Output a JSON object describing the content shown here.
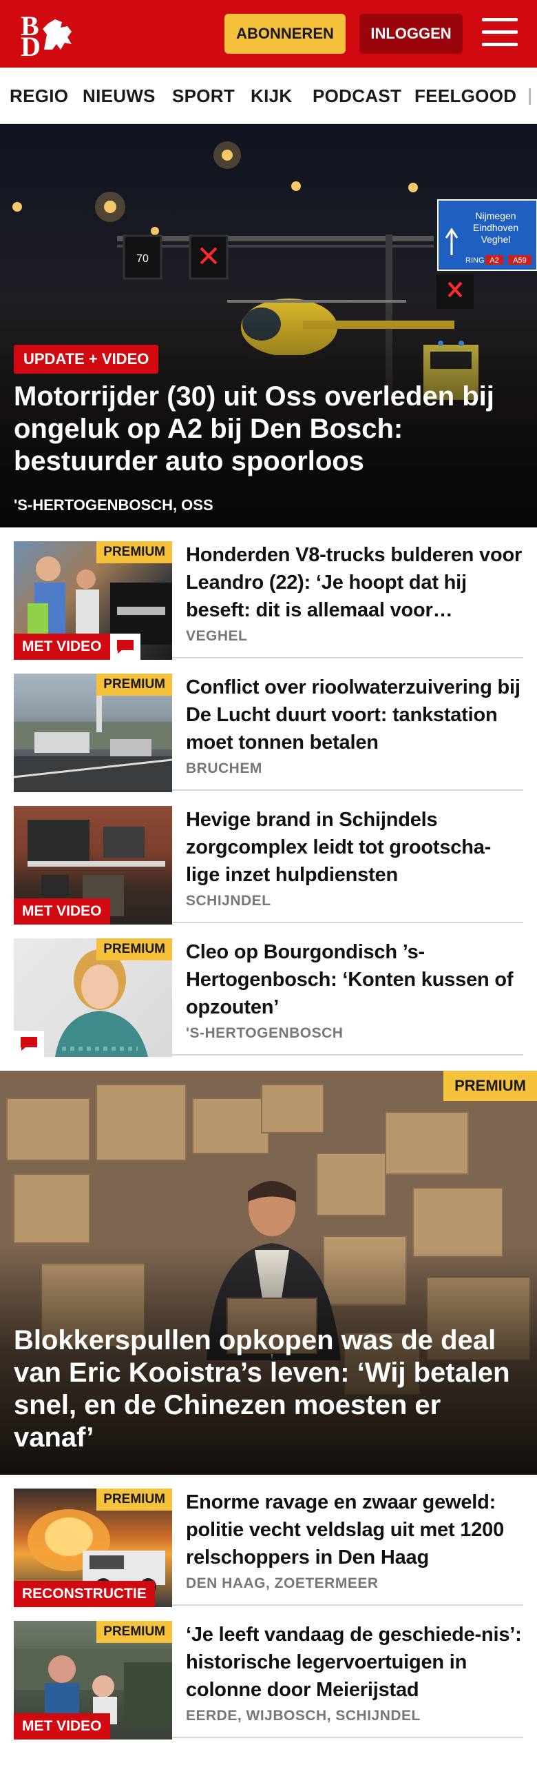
{
  "header": {
    "logo_text": "BD",
    "subscribe_label": "ABONNEREN",
    "login_label": "INLOGGEN",
    "brand_color": "#d10a11",
    "accent_color": "#f6c23c"
  },
  "nav": {
    "items": [
      {
        "label": "REGIO"
      },
      {
        "label": "NIEUWS"
      },
      {
        "label": "SPORT"
      },
      {
        "label": "KIJK"
      },
      {
        "label": "PODCAST"
      },
      {
        "label": "FEELGOOD"
      }
    ]
  },
  "hero": {
    "tag": "UPDATE + VIDEO",
    "title": "Motorrijder (30) uit Oss overleden bij ongeluk op A2 bij Den Bosch: bestuurder auto spoorloos",
    "location": "'S-HERTOGENBOSCH, OSS",
    "scene": {
      "speed_sign": "70",
      "route_sign_lines": [
        "Nijmegen",
        "Eindhoven",
        "Veghel"
      ],
      "route_sign_ring": "RING",
      "route_sign_roads": [
        "A2",
        "A59"
      ]
    }
  },
  "articles": [
    {
      "premium": "PREMIUM",
      "badge": "MET VIDEO",
      "comment_icon": "comment-icon",
      "title": "Honderden V8-trucks bulderen voor Leandro (22): ‘Je hoopt dat hij beseft: dit is allemaal voor…",
      "location": "VEGHEL"
    },
    {
      "premium": "PREMIUM",
      "title": "Conflict over rioolwaterzuivering bij De Lucht duurt voort: tankstation moet tonnen betalen",
      "location": "BRUCHEM"
    },
    {
      "badge": "MET VIDEO",
      "title": "Hevige brand in Schijndels zorgcomplex leidt tot grootscha-lige inzet hulpdiensten",
      "location": "SCHIJNDEL"
    },
    {
      "premium": "PREMIUM",
      "comment_icon": "comment-icon",
      "title": "Cleo op Bourgondisch ’s-Hertogenbosch: ‘Konten kussen of opzouten’",
      "location": "'S-HERTOGENBOSCH"
    }
  ],
  "hero2": {
    "premium": "PREMIUM",
    "title": "Blokkerspullen opkopen was de deal van Eric Kooistra’s leven: ‘Wij betalen snel, en de Chinezen moesten er vanaf’"
  },
  "articles2": [
    {
      "premium": "PREMIUM",
      "badge": "RECONSTRUCTIE",
      "title": "Enorme ravage en zwaar geweld: politie vecht veldslag uit met 1200 relschoppers in Den Haag",
      "location": "DEN HAAG, ZOETERMEER"
    },
    {
      "premium": "PREMIUM",
      "badge": "MET VIDEO",
      "title": "‘Je leeft vandaag de geschiede-nis’: historische legervoertuigen in colonne door Meierijstad",
      "location": "EERDE, WIJBOSCH, SCHIJNDEL"
    }
  ]
}
